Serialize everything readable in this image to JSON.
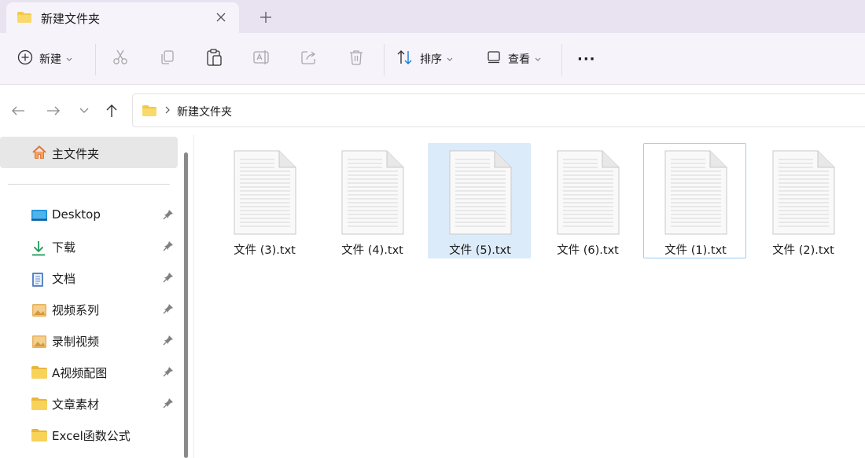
{
  "tab": {
    "title": "新建文件夹"
  },
  "toolbar": {
    "new_label": "新建",
    "sort_label": "排序",
    "view_label": "查看",
    "more_label": "···"
  },
  "address": {
    "path": "新建文件夹"
  },
  "sidebar": {
    "home": {
      "label": "主文件夹",
      "icon": "home-icon"
    },
    "items": [
      {
        "label": "Desktop",
        "icon": "desktop-icon",
        "pinned": true
      },
      {
        "label": "下载",
        "icon": "download-icon",
        "pinned": true
      },
      {
        "label": "文档",
        "icon": "document-icon",
        "pinned": true
      },
      {
        "label": "视频系列",
        "icon": "image-folder-icon",
        "pinned": true
      },
      {
        "label": "录制视频",
        "icon": "image-folder-icon",
        "pinned": true
      },
      {
        "label": "A视频配图",
        "icon": "folder-icon",
        "pinned": true
      },
      {
        "label": "文章素材",
        "icon": "folder-icon",
        "pinned": true
      },
      {
        "label": "Excel函数公式",
        "icon": "folder-icon",
        "pinned": false
      }
    ]
  },
  "files": [
    {
      "name": "文件 (3).txt",
      "state": "normal"
    },
    {
      "name": "文件 (4).txt",
      "state": "normal"
    },
    {
      "name": "文件 (5).txt",
      "state": "selected"
    },
    {
      "name": "文件 (6).txt",
      "state": "normal"
    },
    {
      "name": "文件 (1).txt",
      "state": "focused"
    },
    {
      "name": "文件 (2).txt",
      "state": "normal"
    }
  ],
  "colors": {
    "tab_bar_bg": "#e9e3f1",
    "toolbar_bg": "#f7f3fb",
    "selection_bg": "#dcebfa",
    "focus_border": "#9ecdf0",
    "folder_yellow": "#f2c94c",
    "accent_blue": "#0f7fd6"
  }
}
